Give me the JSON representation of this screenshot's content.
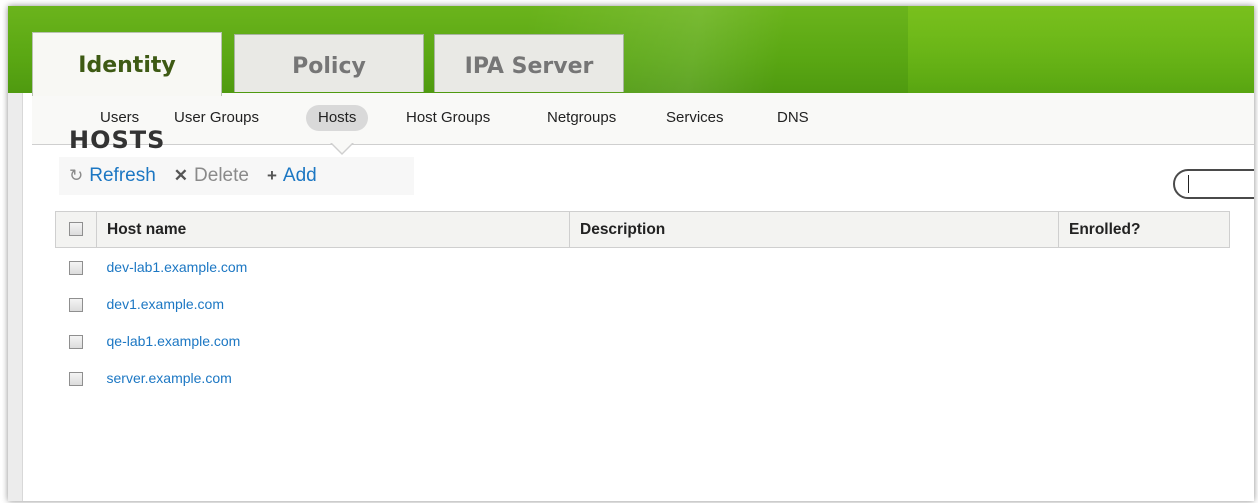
{
  "tabs": [
    {
      "label": "Identity",
      "active": true
    },
    {
      "label": "Policy",
      "active": false
    },
    {
      "label": "IPA Server",
      "active": false
    }
  ],
  "subnav": [
    {
      "label": "Users",
      "active": false
    },
    {
      "label": "User Groups",
      "active": false
    },
    {
      "label": "Hosts",
      "active": true
    },
    {
      "label": "Host Groups",
      "active": false
    },
    {
      "label": "Netgroups",
      "active": false
    },
    {
      "label": "Services",
      "active": false
    },
    {
      "label": "DNS",
      "active": false
    }
  ],
  "page": {
    "title": "HOSTS"
  },
  "actions": {
    "refresh": "Refresh",
    "delete": "Delete",
    "add": "Add",
    "refresh_icon": "refresh-icon",
    "delete_icon": "x-icon",
    "add_icon": "plus-icon"
  },
  "table": {
    "columns": [
      "Host name",
      "Description",
      "Enrolled?"
    ],
    "rows": [
      {
        "host": "dev-lab1.example.com"
      },
      {
        "host": "dev1.example.com"
      },
      {
        "host": "qe-lab1.example.com"
      },
      {
        "host": "server.example.com"
      }
    ]
  },
  "colors": {
    "brand_green": "#5aa713",
    "link_blue": "#1c77c3",
    "active_tab_text": "#3e5a14"
  }
}
